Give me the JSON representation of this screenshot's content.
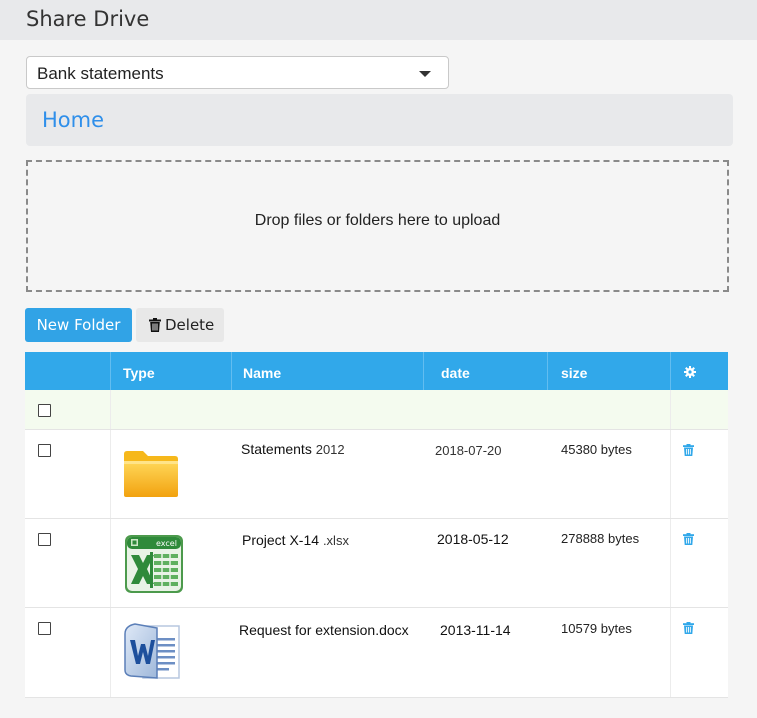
{
  "app": {
    "title": "Share Drive"
  },
  "drive_select": {
    "value": "Bank statements"
  },
  "breadcrumb": {
    "home": "Home"
  },
  "dropzone": {
    "text": "Drop files or folders here to upload"
  },
  "toolbar": {
    "new_folder": "New Folder",
    "delete": "Delete"
  },
  "table": {
    "headers": {
      "type": "Type",
      "name": "Name",
      "date": "date",
      "size": "size"
    },
    "rows": [
      {
        "type_icon": "folder-icon",
        "name": "Statements",
        "ext": "2012",
        "date": "2018-07-20",
        "size": "45380 bytes"
      },
      {
        "type_icon": "excel-file-icon",
        "name": "Project X-14",
        "ext": ".xlsx",
        "date": "2018-05-12",
        "size": "278888 bytes",
        "icon_label": "excel"
      },
      {
        "type_icon": "word-file-icon",
        "name": "Request for extension.docx",
        "ext": "",
        "date": "2013-11-14",
        "size": "10579 bytes"
      }
    ]
  },
  "colors": {
    "accent": "#31a8ea",
    "link": "#2f8fea",
    "row_highlight": "#f4fbef"
  }
}
